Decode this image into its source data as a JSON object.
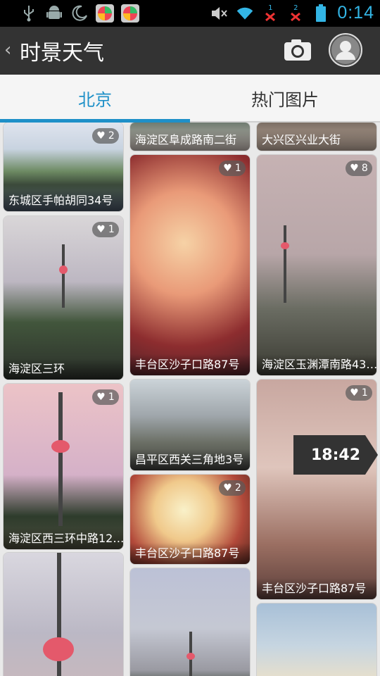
{
  "status_bar": {
    "time": "0:14",
    "icons": [
      "usb-icon",
      "android-icon",
      "moon-icon",
      "app-icon",
      "app-icon",
      "mute-icon",
      "wifi-icon",
      "signal-1-icon",
      "signal-2-icon",
      "battery-icon"
    ],
    "signal_labels": [
      "1",
      "2"
    ]
  },
  "app_bar": {
    "title": "时景天气",
    "icons": [
      "back-chevron-icon",
      "camera-icon",
      "avatar-icon"
    ]
  },
  "tabs": [
    {
      "label": "北京",
      "active": true
    },
    {
      "label": "热门图片",
      "active": false
    }
  ],
  "accent_color": "#1e90c8",
  "cards": {
    "col1_top": {
      "caption": "东城区手帕胡同34号",
      "likes": "2"
    },
    "col1_2": {
      "caption": "海淀区三环",
      "likes": "1"
    },
    "col1_3": {
      "caption": "海淀区西三环中路12…",
      "likes": "1"
    },
    "col1_4": {
      "caption": ""
    },
    "col2_top": {
      "caption": "海淀区阜成路南二街"
    },
    "col2_2": {
      "caption": "丰台区沙子口路87号",
      "likes": "1"
    },
    "col2_3": {
      "caption": "昌平区西关三角地3号"
    },
    "col2_4": {
      "caption": "丰台区沙子口路87号",
      "likes": "2"
    },
    "col3_top": {
      "caption": "大兴区兴业大街"
    },
    "col3_2": {
      "caption": "海淀区玉渊潭南路43…",
      "likes": "8"
    },
    "col3_3": {
      "caption": "丰台区沙子口路87号",
      "likes": "1"
    },
    "time_flag": "18:42"
  }
}
